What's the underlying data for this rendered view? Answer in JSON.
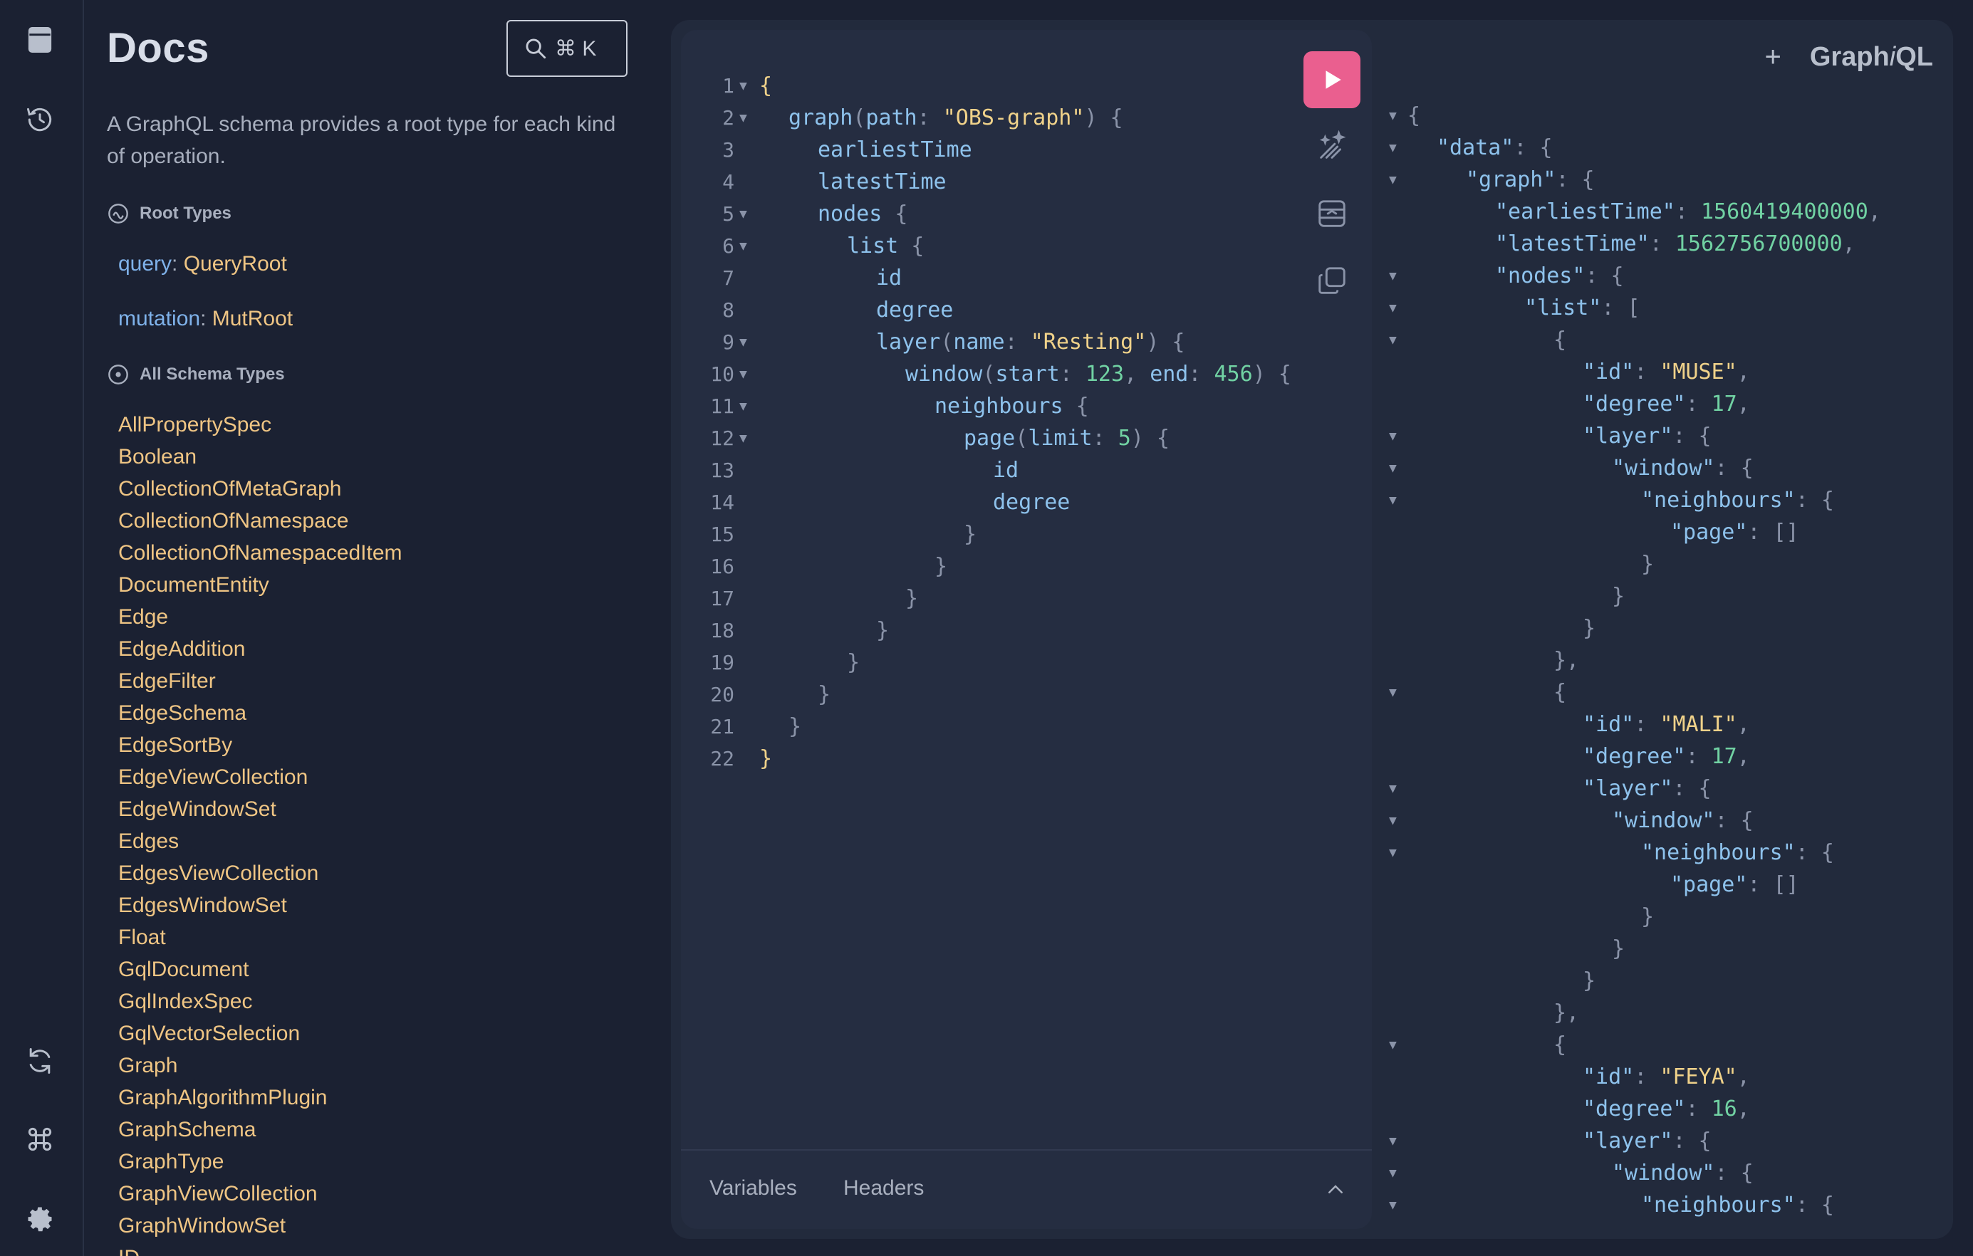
{
  "app": {
    "brand_prefix": "Graph",
    "brand_italic": "i",
    "brand_suffix": "QL"
  },
  "rail": {
    "icons": [
      "docs-book-icon",
      "history-icon",
      "refresh-icon",
      "command-icon",
      "gear-icon"
    ]
  },
  "docs": {
    "title": "Docs",
    "search_shortcut": "⌘ K",
    "description": "A GraphQL schema provides a root type for each kind of operation.",
    "root_types_heading": "Root Types",
    "root_types": [
      {
        "field": "query",
        "type": "QueryRoot"
      },
      {
        "field": "mutation",
        "type": "MutRoot"
      }
    ],
    "all_types_heading": "All Schema Types",
    "types": [
      "AllPropertySpec",
      "Boolean",
      "CollectionOfMetaGraph",
      "CollectionOfNamespace",
      "CollectionOfNamespacedItem",
      "DocumentEntity",
      "Edge",
      "EdgeAddition",
      "EdgeFilter",
      "EdgeSchema",
      "EdgeSortBy",
      "EdgeViewCollection",
      "EdgeWindowSet",
      "Edges",
      "EdgesViewCollection",
      "EdgesWindowSet",
      "Float",
      "GqlDocument",
      "GqlIndexSpec",
      "GqlVectorSelection",
      "Graph",
      "GraphAlgorithmPlugin",
      "GraphSchema",
      "GraphType",
      "GraphViewCollection",
      "GraphWindowSet",
      "ID"
    ]
  },
  "editor": {
    "lines": [
      {
        "n": "1",
        "fold": true,
        "indent": 0,
        "tokens": [
          [
            "brace",
            "{"
          ]
        ]
      },
      {
        "n": "2",
        "fold": true,
        "indent": 1,
        "tokens": [
          [
            "field",
            "graph"
          ],
          [
            "punc",
            "("
          ],
          [
            "arg",
            "path"
          ],
          [
            "punc",
            ": "
          ],
          [
            "str",
            "\"OBS-graph\""
          ],
          [
            "punc",
            ") {"
          ]
        ]
      },
      {
        "n": "3",
        "fold": false,
        "indent": 2,
        "tokens": [
          [
            "field",
            "earliestTime"
          ]
        ]
      },
      {
        "n": "4",
        "fold": false,
        "indent": 2,
        "tokens": [
          [
            "field",
            "latestTime"
          ]
        ]
      },
      {
        "n": "5",
        "fold": true,
        "indent": 2,
        "tokens": [
          [
            "field",
            "nodes"
          ],
          [
            "punc",
            " {"
          ]
        ]
      },
      {
        "n": "6",
        "fold": true,
        "indent": 3,
        "tokens": [
          [
            "field",
            "list"
          ],
          [
            "punc",
            " {"
          ]
        ]
      },
      {
        "n": "7",
        "fold": false,
        "indent": 4,
        "tokens": [
          [
            "field",
            "id"
          ]
        ]
      },
      {
        "n": "8",
        "fold": false,
        "indent": 4,
        "tokens": [
          [
            "field",
            "degree"
          ]
        ]
      },
      {
        "n": "9",
        "fold": true,
        "indent": 4,
        "tokens": [
          [
            "field",
            "layer"
          ],
          [
            "punc",
            "("
          ],
          [
            "arg",
            "name"
          ],
          [
            "punc",
            ": "
          ],
          [
            "str",
            "\"Resting\""
          ],
          [
            "punc",
            ") {"
          ]
        ]
      },
      {
        "n": "10",
        "fold": true,
        "indent": 5,
        "tokens": [
          [
            "field",
            "window"
          ],
          [
            "punc",
            "("
          ],
          [
            "arg",
            "start"
          ],
          [
            "punc",
            ": "
          ],
          [
            "num",
            "123"
          ],
          [
            "punc",
            ", "
          ],
          [
            "arg",
            "end"
          ],
          [
            "punc",
            ": "
          ],
          [
            "num",
            "456"
          ],
          [
            "punc",
            ") {"
          ]
        ]
      },
      {
        "n": "11",
        "fold": true,
        "indent": 6,
        "tokens": [
          [
            "field",
            "neighbours"
          ],
          [
            "punc",
            " {"
          ]
        ]
      },
      {
        "n": "12",
        "fold": true,
        "indent": 7,
        "tokens": [
          [
            "field",
            "page"
          ],
          [
            "punc",
            "("
          ],
          [
            "arg",
            "limit"
          ],
          [
            "punc",
            ": "
          ],
          [
            "num",
            "5"
          ],
          [
            "punc",
            ") {"
          ]
        ]
      },
      {
        "n": "13",
        "fold": false,
        "indent": 8,
        "tokens": [
          [
            "field",
            "id"
          ]
        ]
      },
      {
        "n": "14",
        "fold": false,
        "indent": 8,
        "tokens": [
          [
            "field",
            "degree"
          ]
        ]
      },
      {
        "n": "15",
        "fold": false,
        "indent": 7,
        "tokens": [
          [
            "punc",
            "}"
          ]
        ]
      },
      {
        "n": "16",
        "fold": false,
        "indent": 6,
        "tokens": [
          [
            "punc",
            "}"
          ]
        ]
      },
      {
        "n": "17",
        "fold": false,
        "indent": 5,
        "tokens": [
          [
            "punc",
            "}"
          ]
        ]
      },
      {
        "n": "18",
        "fold": false,
        "indent": 4,
        "tokens": [
          [
            "punc",
            "}"
          ]
        ]
      },
      {
        "n": "19",
        "fold": false,
        "indent": 3,
        "tokens": [
          [
            "punc",
            "}"
          ]
        ]
      },
      {
        "n": "20",
        "fold": false,
        "indent": 2,
        "tokens": [
          [
            "punc",
            "}"
          ]
        ]
      },
      {
        "n": "21",
        "fold": false,
        "indent": 1,
        "tokens": [
          [
            "punc",
            "}"
          ]
        ]
      },
      {
        "n": "22",
        "fold": false,
        "indent": 0,
        "tokens": [
          [
            "brace",
            "}"
          ]
        ]
      }
    ],
    "tabs": {
      "variables": "Variables",
      "headers": "Headers"
    },
    "accent": "#ea5f8f"
  },
  "result": {
    "lines": [
      {
        "fold": true,
        "indent": 0,
        "tokens": [
          [
            "punc",
            "{"
          ]
        ]
      },
      {
        "fold": true,
        "indent": 1,
        "tokens": [
          [
            "key",
            "\"data\""
          ],
          [
            "punc",
            ": {"
          ]
        ]
      },
      {
        "fold": true,
        "indent": 2,
        "tokens": [
          [
            "key",
            "\"graph\""
          ],
          [
            "punc",
            ": {"
          ]
        ]
      },
      {
        "fold": false,
        "indent": 3,
        "tokens": [
          [
            "key",
            "\"earliestTime\""
          ],
          [
            "punc",
            ": "
          ],
          [
            "num",
            "1560419400000"
          ],
          [
            "punc",
            ","
          ]
        ]
      },
      {
        "fold": false,
        "indent": 3,
        "tokens": [
          [
            "key",
            "\"latestTime\""
          ],
          [
            "punc",
            ": "
          ],
          [
            "num",
            "1562756700000"
          ],
          [
            "punc",
            ","
          ]
        ]
      },
      {
        "fold": true,
        "indent": 3,
        "tokens": [
          [
            "key",
            "\"nodes\""
          ],
          [
            "punc",
            ": {"
          ]
        ]
      },
      {
        "fold": true,
        "indent": 4,
        "tokens": [
          [
            "key",
            "\"list\""
          ],
          [
            "punc",
            ": ["
          ]
        ]
      },
      {
        "fold": true,
        "indent": 5,
        "tokens": [
          [
            "punc",
            "{"
          ]
        ]
      },
      {
        "fold": false,
        "indent": 6,
        "tokens": [
          [
            "key",
            "\"id\""
          ],
          [
            "punc",
            ": "
          ],
          [
            "str",
            "\"MUSE\""
          ],
          [
            "punc",
            ","
          ]
        ]
      },
      {
        "fold": false,
        "indent": 6,
        "tokens": [
          [
            "key",
            "\"degree\""
          ],
          [
            "punc",
            ": "
          ],
          [
            "num",
            "17"
          ],
          [
            "punc",
            ","
          ]
        ]
      },
      {
        "fold": true,
        "indent": 6,
        "tokens": [
          [
            "key",
            "\"layer\""
          ],
          [
            "punc",
            ": {"
          ]
        ]
      },
      {
        "fold": true,
        "indent": 7,
        "tokens": [
          [
            "key",
            "\"window\""
          ],
          [
            "punc",
            ": {"
          ]
        ]
      },
      {
        "fold": true,
        "indent": 8,
        "tokens": [
          [
            "key",
            "\"neighbours\""
          ],
          [
            "punc",
            ": {"
          ]
        ]
      },
      {
        "fold": false,
        "indent": 9,
        "tokens": [
          [
            "key",
            "\"page\""
          ],
          [
            "punc",
            ": []"
          ]
        ]
      },
      {
        "fold": false,
        "indent": 8,
        "tokens": [
          [
            "punc",
            "}"
          ]
        ]
      },
      {
        "fold": false,
        "indent": 7,
        "tokens": [
          [
            "punc",
            "}"
          ]
        ]
      },
      {
        "fold": false,
        "indent": 6,
        "tokens": [
          [
            "punc",
            "}"
          ]
        ]
      },
      {
        "fold": false,
        "indent": 5,
        "tokens": [
          [
            "punc",
            "},"
          ]
        ]
      },
      {
        "fold": true,
        "indent": 5,
        "tokens": [
          [
            "punc",
            "{"
          ]
        ]
      },
      {
        "fold": false,
        "indent": 6,
        "tokens": [
          [
            "key",
            "\"id\""
          ],
          [
            "punc",
            ": "
          ],
          [
            "str",
            "\"MALI\""
          ],
          [
            "punc",
            ","
          ]
        ]
      },
      {
        "fold": false,
        "indent": 6,
        "tokens": [
          [
            "key",
            "\"degree\""
          ],
          [
            "punc",
            ": "
          ],
          [
            "num",
            "17"
          ],
          [
            "punc",
            ","
          ]
        ]
      },
      {
        "fold": true,
        "indent": 6,
        "tokens": [
          [
            "key",
            "\"layer\""
          ],
          [
            "punc",
            ": {"
          ]
        ]
      },
      {
        "fold": true,
        "indent": 7,
        "tokens": [
          [
            "key",
            "\"window\""
          ],
          [
            "punc",
            ": {"
          ]
        ]
      },
      {
        "fold": true,
        "indent": 8,
        "tokens": [
          [
            "key",
            "\"neighbours\""
          ],
          [
            "punc",
            ": {"
          ]
        ]
      },
      {
        "fold": false,
        "indent": 9,
        "tokens": [
          [
            "key",
            "\"page\""
          ],
          [
            "punc",
            ": []"
          ]
        ]
      },
      {
        "fold": false,
        "indent": 8,
        "tokens": [
          [
            "punc",
            "}"
          ]
        ]
      },
      {
        "fold": false,
        "indent": 7,
        "tokens": [
          [
            "punc",
            "}"
          ]
        ]
      },
      {
        "fold": false,
        "indent": 6,
        "tokens": [
          [
            "punc",
            "}"
          ]
        ]
      },
      {
        "fold": false,
        "indent": 5,
        "tokens": [
          [
            "punc",
            "},"
          ]
        ]
      },
      {
        "fold": true,
        "indent": 5,
        "tokens": [
          [
            "punc",
            "{"
          ]
        ]
      },
      {
        "fold": false,
        "indent": 6,
        "tokens": [
          [
            "key",
            "\"id\""
          ],
          [
            "punc",
            ": "
          ],
          [
            "str",
            "\"FEYA\""
          ],
          [
            "punc",
            ","
          ]
        ]
      },
      {
        "fold": false,
        "indent": 6,
        "tokens": [
          [
            "key",
            "\"degree\""
          ],
          [
            "punc",
            ": "
          ],
          [
            "num",
            "16"
          ],
          [
            "punc",
            ","
          ]
        ]
      },
      {
        "fold": true,
        "indent": 6,
        "tokens": [
          [
            "key",
            "\"layer\""
          ],
          [
            "punc",
            ": {"
          ]
        ]
      },
      {
        "fold": true,
        "indent": 7,
        "tokens": [
          [
            "key",
            "\"window\""
          ],
          [
            "punc",
            ": {"
          ]
        ]
      },
      {
        "fold": true,
        "indent": 8,
        "tokens": [
          [
            "key",
            "\"neighbours\""
          ],
          [
            "punc",
            ": {"
          ]
        ]
      }
    ]
  }
}
